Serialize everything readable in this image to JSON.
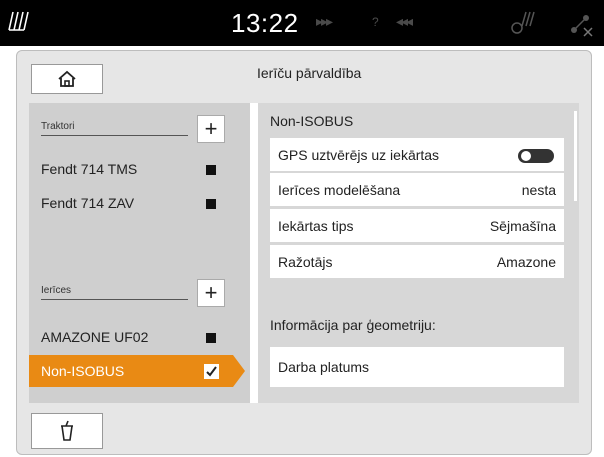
{
  "topbar": {
    "time": "13:22",
    "arrows_right": "▸▸▸",
    "question": "?",
    "arrows_left": "◂◂◂"
  },
  "header": {
    "title": "Ierīču pārvaldība"
  },
  "sidebar": {
    "tractors_label": "Traktori",
    "tractors": [
      {
        "label": "Fendt 714 TMS"
      },
      {
        "label": "Fendt 714 ZAV"
      }
    ],
    "devices_label": "Ierīces",
    "devices": [
      {
        "label": "AMAZONE UF02"
      },
      {
        "label": "Non-ISOBUS"
      }
    ]
  },
  "detail": {
    "heading": "Non-ISOBUS",
    "rows": [
      {
        "label": "GPS uztvērējs uz iekārtas",
        "value": ""
      },
      {
        "label": "Ierīces modelēšana",
        "value": "nesta"
      },
      {
        "label": "Iekārtas tips",
        "value": "Sējmašīna"
      },
      {
        "label": "Ražotājs",
        "value": "Amazone"
      }
    ],
    "geometry_heading": "Informācija par ģeometriju:",
    "working_width_label": "Darba platums"
  }
}
